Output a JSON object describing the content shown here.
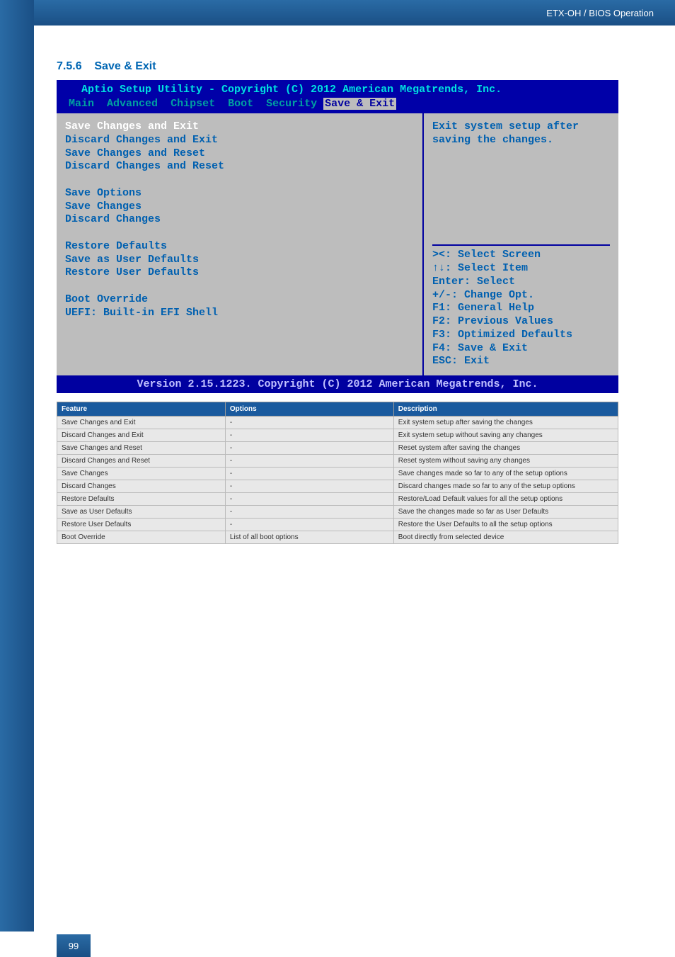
{
  "header": {
    "breadcrumb": "ETX-OH / BIOS Operation"
  },
  "page_number": "99",
  "section": {
    "number": "7.5.6",
    "title": "Save & Exit"
  },
  "bios": {
    "title": "   Aptio Setup Utility - Copyright (C) 2012 American Megatrends, Inc.",
    "tabs": [
      "Main",
      "Advanced",
      "Chipset",
      "Boot",
      "Security",
      "Save & Exit"
    ],
    "active_tab": "Save & Exit",
    "left_items_group1": [
      "Save Changes and Exit",
      "Discard Changes and Exit",
      "Save Changes and Reset",
      "Discard Changes and Reset"
    ],
    "left_items_group2_heading": "Save Options",
    "left_items_group2": [
      "Save Changes",
      "Discard Changes"
    ],
    "left_items_group3": [
      "Restore Defaults",
      "Save as User Defaults",
      "Restore User Defaults"
    ],
    "left_items_group4": [
      "Boot Override",
      "UEFI: Built-in EFI Shell"
    ],
    "description": "Exit system setup after saving the changes.",
    "help_keys": [
      "><: Select Screen",
      "↑↓: Select Item",
      "Enter: Select",
      "+/-: Change Opt.",
      "F1: General Help",
      "F2: Previous Values",
      "F3: Optimized Defaults",
      "F4: Save & Exit",
      "ESC: Exit"
    ],
    "footer": "Version 2.15.1223. Copyright (C) 2012 American Megatrends, Inc."
  },
  "table": {
    "headers": [
      "Feature",
      "Options",
      "Description"
    ],
    "rows": [
      {
        "feature": "Save Changes and Exit",
        "options": "-",
        "description": "Exit system setup after saving the changes"
      },
      {
        "feature": "Discard Changes and Exit",
        "options": "-",
        "description": "Exit system setup without saving any changes"
      },
      {
        "feature": "Save Changes and Reset",
        "options": "-",
        "description": "Reset system after saving the changes"
      },
      {
        "feature": "Discard Changes and Reset",
        "options": "-",
        "description": "Reset system without saving any changes"
      },
      {
        "feature": "Save Changes",
        "options": "-",
        "description": "Save changes made so far to any of the setup options"
      },
      {
        "feature": "Discard Changes",
        "options": "-",
        "description": "Discard changes made so far to any of the setup options"
      },
      {
        "feature": "Restore Defaults",
        "options": "-",
        "description": "Restore/Load Default values for all the setup options"
      },
      {
        "feature": "Save as User Defaults",
        "options": "-",
        "description": "Save the changes made so far as User Defaults"
      },
      {
        "feature": "Restore User Defaults",
        "options": "-",
        "description": "Restore the User Defaults to all the setup options"
      },
      {
        "feature": "Boot Override",
        "options": "List of all boot options",
        "description": "Boot directly from selected device"
      }
    ]
  }
}
